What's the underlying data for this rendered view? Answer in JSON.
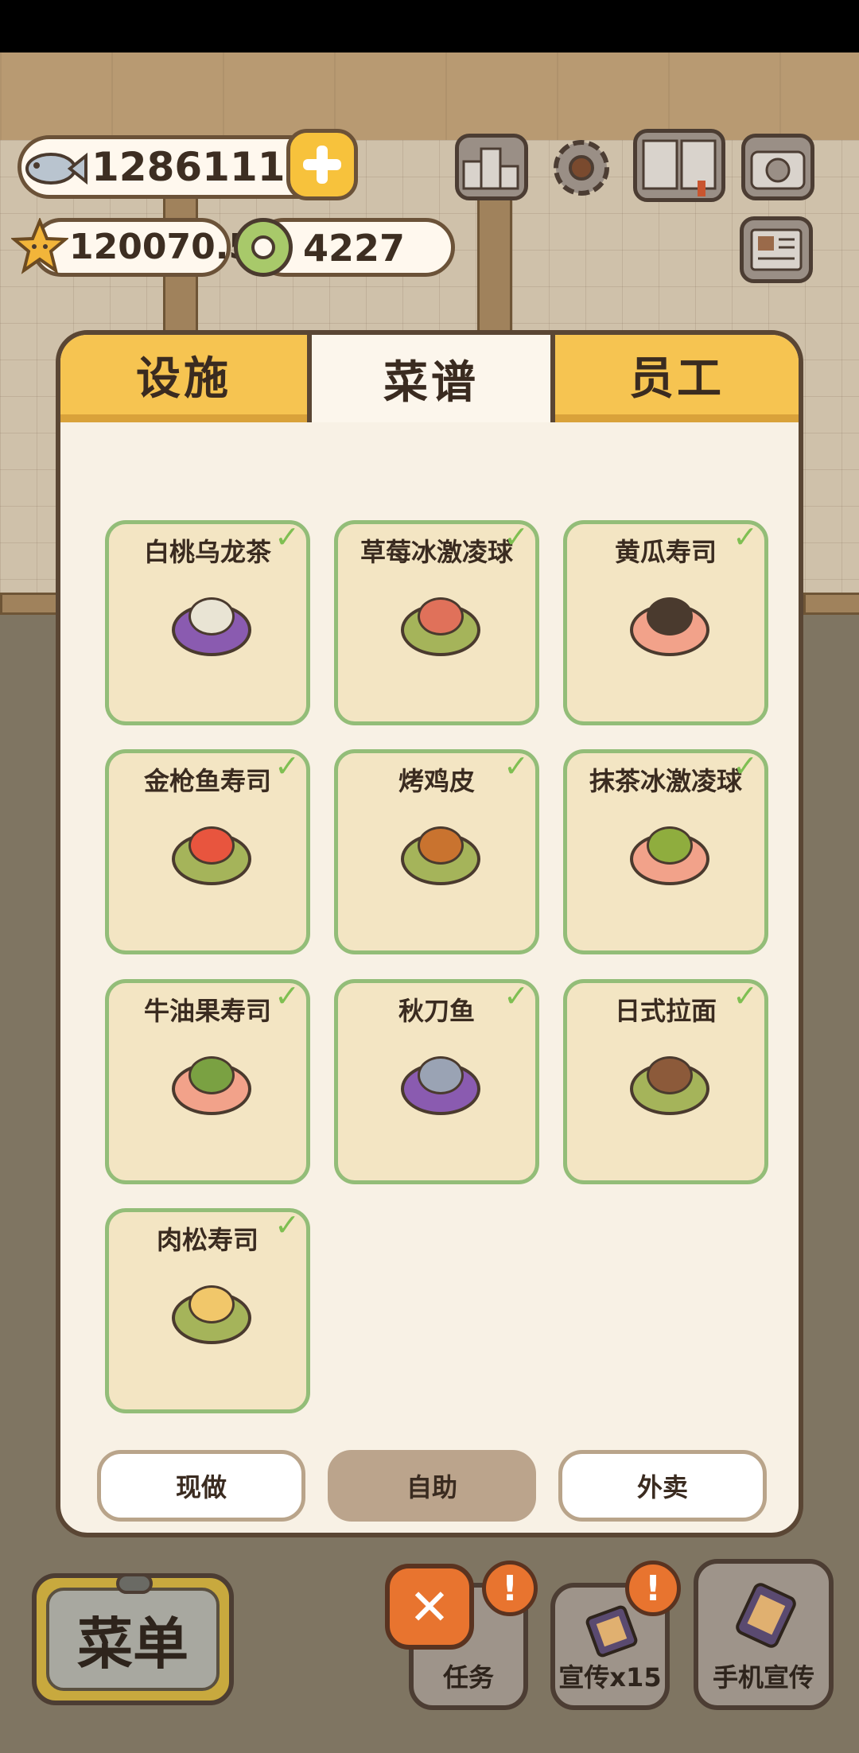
{
  "currency": {
    "fish": "12861112",
    "stars": "120070.5",
    "rings": "4227"
  },
  "tabs": [
    "设施",
    "菜谱",
    "员工"
  ],
  "active_tab": "菜谱",
  "recipes": [
    {
      "name": "白桃乌龙茶",
      "checked": true,
      "plate": "#8a5bb0",
      "food": "#e9e4d4"
    },
    {
      "name": "草莓冰激凌球",
      "checked": true,
      "plate": "#a5b45a",
      "food": "#e0715a"
    },
    {
      "name": "黄瓜寿司",
      "checked": true,
      "plate": "#f2a28a",
      "food": "#4a3a2e"
    },
    {
      "name": "金枪鱼寿司",
      "checked": true,
      "plate": "#a5b45a",
      "food": "#e8553e"
    },
    {
      "name": "烤鸡皮",
      "checked": true,
      "plate": "#a5b45a",
      "food": "#c9732f"
    },
    {
      "name": "抹茶冰激凌球",
      "checked": true,
      "plate": "#f2a28a",
      "food": "#8fad3e"
    },
    {
      "name": "牛油果寿司",
      "checked": true,
      "plate": "#f2a28a",
      "food": "#7aa142"
    },
    {
      "name": "秋刀鱼",
      "checked": true,
      "plate": "#8a5bb0",
      "food": "#9aa3b4"
    },
    {
      "name": "日式拉面",
      "checked": true,
      "plate": "#a5b45a",
      "food": "#8c5a3a"
    },
    {
      "name": "肉松寿司",
      "checked": true,
      "plate": "#a5b45a",
      "food": "#f1c76a"
    }
  ],
  "check_mark": "✓",
  "modes": [
    "现做",
    "自助",
    "外卖"
  ],
  "active_mode": "自助",
  "bottom": {
    "menu": "菜单",
    "tasks": "任务",
    "promo": "宣传x15",
    "phone_promo": "手机宣传",
    "alert_mark": "!",
    "close_mark": "✕"
  },
  "colors": {
    "tab_yellow": "#f6c451",
    "card_bg": "#f3e5c3",
    "card_border": "#93bd78",
    "check": "#7fbf52",
    "close": "#e8742f"
  }
}
